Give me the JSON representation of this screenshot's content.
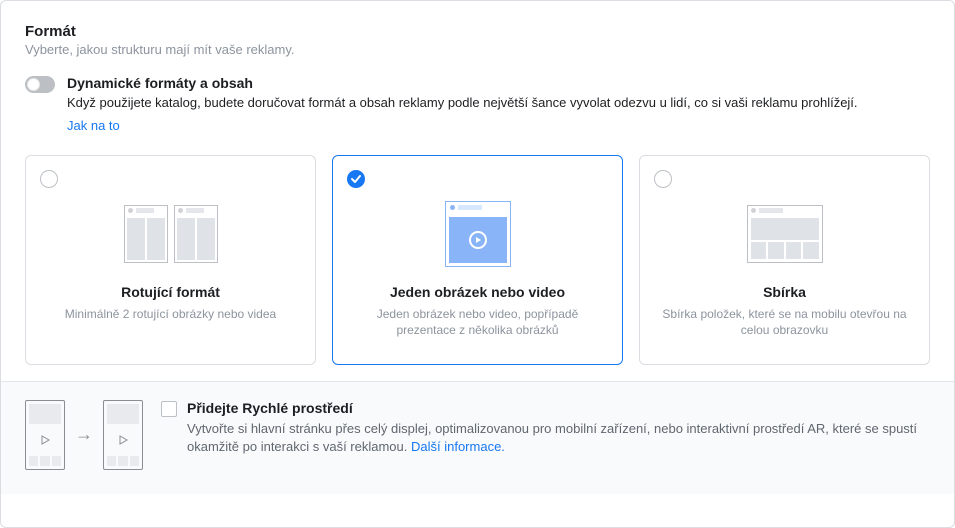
{
  "section": {
    "title": "Formát",
    "subtitle": "Vyberte, jakou strukturu mají mít vaše reklamy."
  },
  "dynamic": {
    "title": "Dynamické formáty a obsah",
    "desc": "Když použijete katalog, budete doručovat formát a obsah reklamy podle největší šance vyvolat odezvu u lidí, co si vaši reklamu prohlížejí.",
    "howto": "Jak na to"
  },
  "cards": {
    "carousel": {
      "title": "Rotující formát",
      "desc": "Minimálně 2 rotující obrázky nebo videa"
    },
    "single": {
      "title": "Jeden obrázek nebo video",
      "desc": "Jeden obrázek nebo video, popřípadě prezentace z několika obrázků"
    },
    "collection": {
      "title": "Sbírka",
      "desc": "Sbírka položek, které se na mobilu otevřou na celou obrazovku"
    }
  },
  "footer": {
    "title": "Přidejte Rychlé prostředí",
    "desc": "Vytvořte si hlavní stránku přes celý displej, optimalizovanou pro mobilní zařízení, nebo interaktivní prostředí AR, které se spustí okamžitě po interakci s vaší reklamou. ",
    "link": "Další informace."
  }
}
